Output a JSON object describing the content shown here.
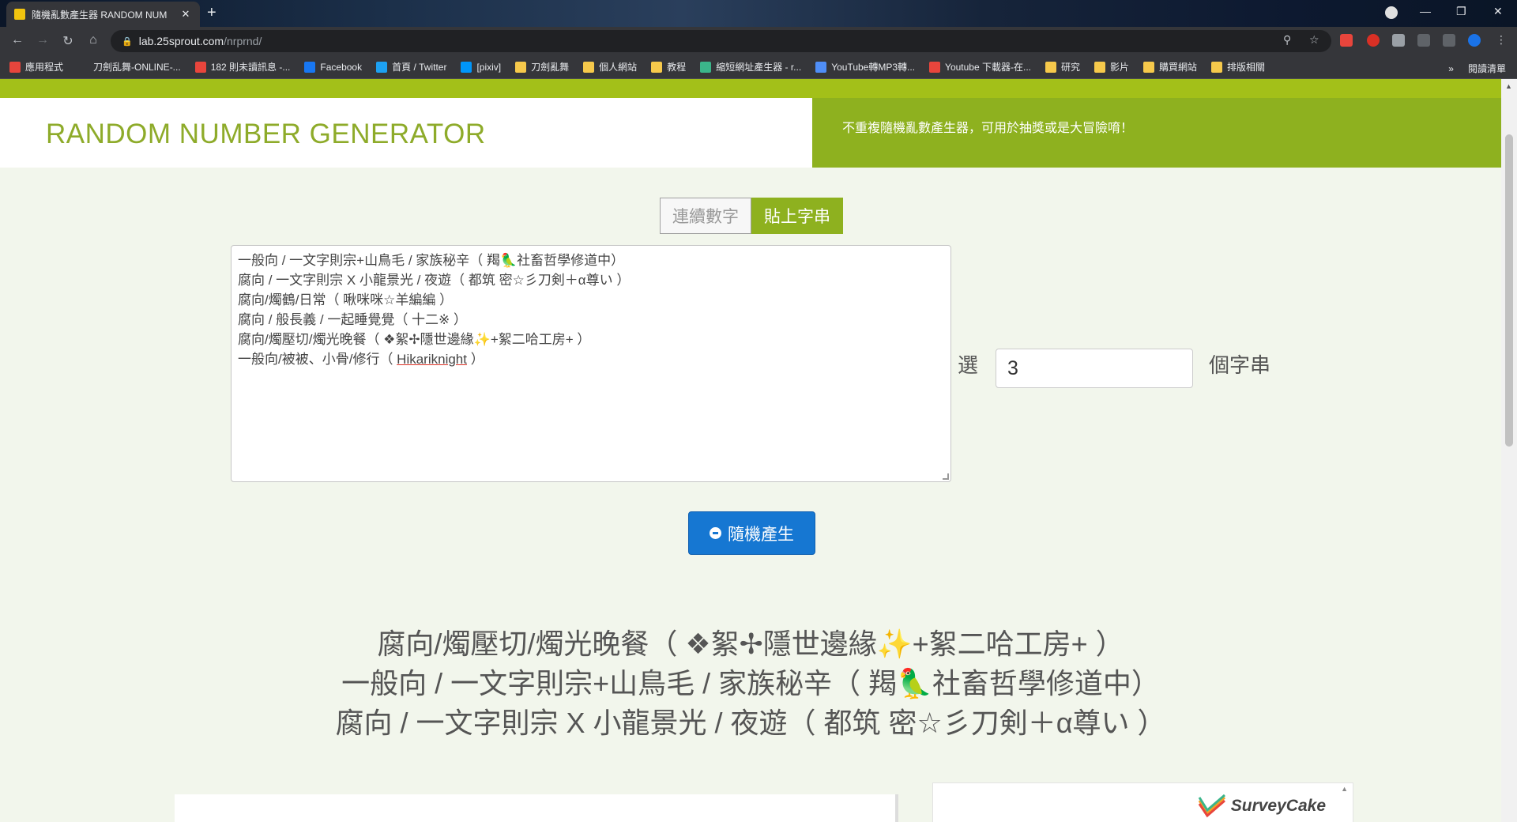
{
  "browser": {
    "tab_title": "隨機亂數產生器 RANDOM NUM",
    "tab_close": "✕",
    "new_tab": "+",
    "url_host": "lab.25sprout.com",
    "url_path": "/nrprnd/",
    "ext_badge": "2",
    "bookmarks": [
      {
        "label": "應用程式",
        "icon_color": "#e8453c"
      },
      {
        "label": "刀劍乱舞-ONLINE-...",
        "icon_color": "#35363a"
      },
      {
        "label": "182 則未讀訊息 -...",
        "icon_color": "#e8453c"
      },
      {
        "label": "Facebook",
        "icon_color": "#1877f2"
      },
      {
        "label": "首頁 / Twitter",
        "icon_color": "#1da1f2"
      },
      {
        "label": "[pixiv]",
        "icon_color": "#0096fa"
      },
      {
        "label": "刀劍亂舞",
        "icon_color": "#f6c94b"
      },
      {
        "label": "個人網站",
        "icon_color": "#f6c94b"
      },
      {
        "label": "教程",
        "icon_color": "#f6c94b"
      },
      {
        "label": "縮短網址產生器 - r...",
        "icon_color": "#3bb58a"
      },
      {
        "label": "YouTube轉MP3轉...",
        "icon_color": "#4f8ef7"
      },
      {
        "label": "Youtube 下載器-在...",
        "icon_color": "#e8453c"
      },
      {
        "label": "研究",
        "icon_color": "#f6c94b"
      },
      {
        "label": "影片",
        "icon_color": "#f6c94b"
      },
      {
        "label": "購買網站",
        "icon_color": "#f6c94b"
      },
      {
        "label": "排版相關",
        "icon_color": "#f6c94b"
      }
    ],
    "bookmarks_more": "»",
    "reading_list": "閱讀清單"
  },
  "header": {
    "title": "RANDOM NUMBER GENERATOR",
    "tagline": "不重複隨機亂數產生器，可用於抽獎或是大冒險唷！"
  },
  "modes": {
    "sequential": "連續數字",
    "paste": "貼上字串",
    "active": "paste"
  },
  "input": {
    "lines": [
      "一般向 / 一文字則宗+山鳥毛 / 家族秘辛（ 羯🦜社畜哲學修道中）",
      "腐向 / 一文字則宗 X 小龍景光 / 夜遊（ 都筑 密☆彡刀剣＋α尊い ）",
      "腐向/燭鶴/日常（ 啾咪咪☆羊編編 ）",
      "腐向 / 般長義 / 一起睡覺覺（ 十二※ ）",
      "腐向/燭壓切/燭光晚餐（ ❖絮✢隱世邊緣✨+絮二哈工房+ ）",
      "一般向/被被、小骨/修行（ "
    ],
    "last_line_link": "Hikariknight",
    "last_line_tail": " ）",
    "select_prefix": "選",
    "count": "3",
    "select_suffix": "個字串"
  },
  "generate_button": "隨機產生",
  "results": [
    "腐向/燭壓切/燭光晚餐（ ❖絮✢隱世邊緣✨+絮二哈工房+ ）",
    "一般向 / 一文字則宗+山鳥毛 / 家族秘辛（ 羯🦜社畜哲學修道中）",
    "腐向 / 一文字則宗 X 小龍景光 / 夜遊（ 都筑 密☆彡刀剣＋α尊い ）"
  ],
  "ad": {
    "brand": "SurveyCake"
  },
  "colors": {
    "lime": "#a3c019",
    "olive_green": "#8eb11f",
    "button_blue": "#1677d2"
  }
}
